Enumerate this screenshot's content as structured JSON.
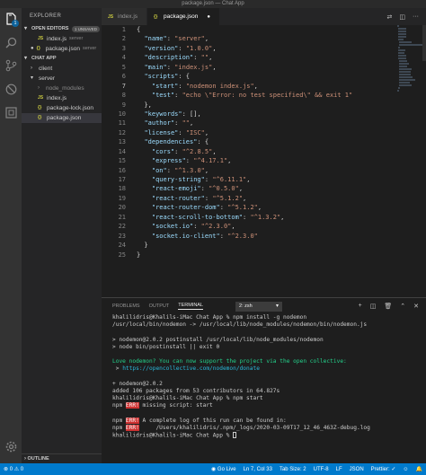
{
  "window": {
    "title": "package.json — Chat App"
  },
  "sidebar": {
    "title": "EXPLORER",
    "open_editors": {
      "label": "OPEN EDITORS",
      "badge": "1 UNSAVED",
      "items": [
        {
          "name": "index.js",
          "folder": "server"
        },
        {
          "name": "package.json",
          "folder": "server"
        }
      ]
    },
    "project": {
      "label": "CHAT APP",
      "tree": [
        "client",
        "server",
        "node_modules",
        "index.js",
        "package-lock.json",
        "package.json"
      ]
    },
    "outline_label": "OUTLINE"
  },
  "tabs": [
    {
      "label": "index.js",
      "icon": "JS"
    },
    {
      "label": "package.json",
      "icon": "{}"
    }
  ],
  "editor": {
    "current_line": 7,
    "lines": [
      "{",
      "  \"name\": \"server\",",
      "  \"version\": \"1.0.0\",",
      "  \"description\": \"\",",
      "  \"main\": \"index.js\",",
      "  \"scripts\": {",
      "    \"start\": \"nodemon index.js\",",
      "    \"test\": \"echo \\\"Error: no test specified\\\" && exit 1\"",
      "  },",
      "  \"keywords\": [],",
      "  \"author\": \"\",",
      "  \"license\": \"ISC\",",
      "  \"dependencies\": {",
      "    \"cors\": \"^2.8.5\",",
      "    \"express\": \"^4.17.1\",",
      "    \"on\": \"^1.3.0\",",
      "    \"query-string\": \"^6.11.1\",",
      "    \"react-emoji\": \"^0.5.0\",",
      "    \"react-router\": \"^5.1.2\",",
      "    \"react-router-dom\": \"^5.1.2\",",
      "    \"react-scroll-to-bottom\": \"^1.3.2\",",
      "    \"socket.io\": \"^2.3.0\",",
      "    \"socket.io-client\": \"^2.3.0\"",
      "  }",
      "}"
    ]
  },
  "panel": {
    "tabs": [
      "PROBLEMS",
      "OUTPUT",
      "TERMINAL"
    ],
    "shell": "2: zsh",
    "terminal": [
      {
        "text": "khalilidris@Khalils-iMac Chat App % npm install -g nodemon",
        "style": ""
      },
      {
        "text": "/usr/local/bin/nodemon -> /usr/local/lib/node_modules/nodemon/bin/nodemon.js",
        "style": ""
      },
      {
        "text": "",
        "style": ""
      },
      {
        "text": "> nodemon@2.0.2 postinstall /usr/local/lib/node_modules/nodemon",
        "style": ""
      },
      {
        "text": "> node bin/postinstall || exit 0",
        "style": ""
      },
      {
        "text": "",
        "style": ""
      },
      {
        "text": "Love nodemon? You can now support the project via the open collective:",
        "style": "green"
      },
      {
        "text": " > https://opencollective.com/nodemon/donate",
        "style": "cyan"
      },
      {
        "text": "",
        "style": ""
      },
      {
        "text": "+ nodemon@2.0.2",
        "style": ""
      },
      {
        "text": "added 106 packages from 53 contributors in 64.827s",
        "style": ""
      },
      {
        "text": "khalilidris@Khalils-iMac Chat App % npm start",
        "style": ""
      },
      {
        "text": "npm ERR! missing script: start",
        "style": "err"
      },
      {
        "text": "",
        "style": ""
      },
      {
        "text": "npm ERR! A complete log of this run can be found in:",
        "style": "err"
      },
      {
        "text": "npm ERR!     /Users/khalilidris/.npm/_logs/2020-03-09T17_12_46_463Z-debug.log",
        "style": "err"
      },
      {
        "text": "khalilidris@Khalils-iMac Chat App % ",
        "style": "prompt"
      }
    ]
  },
  "statusbar": {
    "errors": "0",
    "warnings": "0",
    "golive": "Go Live",
    "position": "Ln 7, Col 33",
    "tabsize": "Tab Size: 2",
    "encoding": "UTF-8",
    "eol": "LF",
    "language": "JSON",
    "prettier": "Prettier: ✓"
  },
  "colors": {
    "statusbar": "#007acc",
    "key": "#9cdcfe",
    "string": "#ce9178",
    "error_bg": "#cd3131"
  }
}
